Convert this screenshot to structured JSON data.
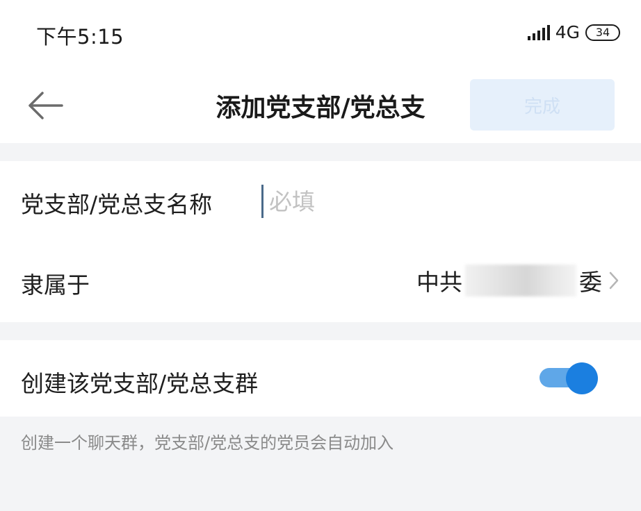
{
  "status_bar": {
    "time": "下午5:15",
    "network": "4G",
    "battery": "34"
  },
  "header": {
    "title": "添加党支部/党总支",
    "done_label": "完成"
  },
  "form": {
    "name_label": "党支部/党总支名称",
    "name_placeholder": "必填",
    "name_value": "",
    "parent_label": "隶属于",
    "parent_prefix": "中共",
    "parent_suffix": "委"
  },
  "group": {
    "toggle_label": "创建该党支部/党总支群",
    "toggle_on": true,
    "hint": "创建一个聊天群，党支部/党总支的党员会自动加入"
  },
  "colors": {
    "accent": "#1b7fe0",
    "toggle_track": "#5fa7e8",
    "done_bg": "#e6f0fb"
  }
}
